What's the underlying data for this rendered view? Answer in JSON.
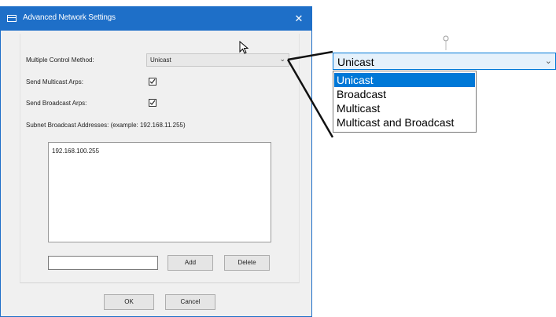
{
  "dialog": {
    "title": "Advanced Network Settings",
    "close_glyph": "✕",
    "multiple_control_method_label": "Multiple Control Method:",
    "multiple_control_method_value": "Unicast",
    "send_multicast_label": "Send Multicast Arps:",
    "send_multicast_checked": true,
    "send_broadcast_label": "Send Broadcast Arps:",
    "send_broadcast_checked": true,
    "subnet_label": "Subnet Broadcast Addresses: (example: 192.168.11.255)",
    "subnet_addresses": [
      "192.168.100.255"
    ],
    "new_address_value": "",
    "add_label": "Add",
    "delete_label": "Delete",
    "ok_label": "OK",
    "cancel_label": "Cancel"
  },
  "callout": {
    "combo_value": "Unicast",
    "options": [
      "Unicast",
      "Broadcast",
      "Multicast",
      "Multicast and Broadcast"
    ],
    "selected_option": "Unicast"
  },
  "icons": {
    "dropdown_arrow": "chevron-down-icon",
    "checkbox_mark": "checkmark-icon",
    "window": "window-icon",
    "cursor": "mouse-cursor-icon",
    "pin": "pin-icon"
  },
  "colors": {
    "titlebar": "#1e6fc8",
    "selection": "#0078d7",
    "dialog_background": "#f0f0f0"
  }
}
